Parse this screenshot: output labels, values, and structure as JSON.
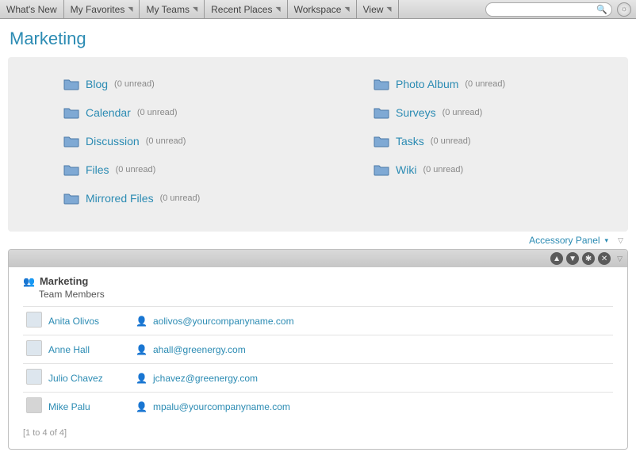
{
  "menu": {
    "items": [
      {
        "label": "What's New",
        "has_caret": false
      },
      {
        "label": "My Favorites",
        "has_caret": true
      },
      {
        "label": "My Teams",
        "has_caret": true
      },
      {
        "label": "Recent Places",
        "has_caret": true
      },
      {
        "label": "Workspace",
        "has_caret": true
      },
      {
        "label": "View",
        "has_caret": true
      }
    ]
  },
  "search": {
    "placeholder": ""
  },
  "page": {
    "title": "Marketing"
  },
  "folders": {
    "left": [
      {
        "name": "Blog",
        "unread": "(0 unread)"
      },
      {
        "name": "Calendar",
        "unread": "(0 unread)"
      },
      {
        "name": "Discussion",
        "unread": "(0 unread)"
      },
      {
        "name": "Files",
        "unread": "(0 unread)"
      },
      {
        "name": "Mirrored Files",
        "unread": "(0 unread)"
      }
    ],
    "right": [
      {
        "name": "Photo Album",
        "unread": "(0 unread)"
      },
      {
        "name": "Surveys",
        "unread": "(0 unread)"
      },
      {
        "name": "Tasks",
        "unread": "(0 unread)"
      },
      {
        "name": "Wiki",
        "unread": "(0 unread)"
      }
    ]
  },
  "accessory": {
    "label": "Accessory Panel"
  },
  "team_panel": {
    "title": "Marketing",
    "subtitle": "Team Members",
    "members": [
      {
        "name": "Anita Olivos",
        "email": "aolivos@yourcompanyname.com"
      },
      {
        "name": "Anne Hall",
        "email": "ahall@greenergy.com"
      },
      {
        "name": "Julio Chavez",
        "email": "jchavez@greenergy.com"
      },
      {
        "name": "Mike Palu",
        "email": "mpalu@yourcompanyname.com"
      }
    ],
    "pager": "[1 to 4 of 4]"
  }
}
